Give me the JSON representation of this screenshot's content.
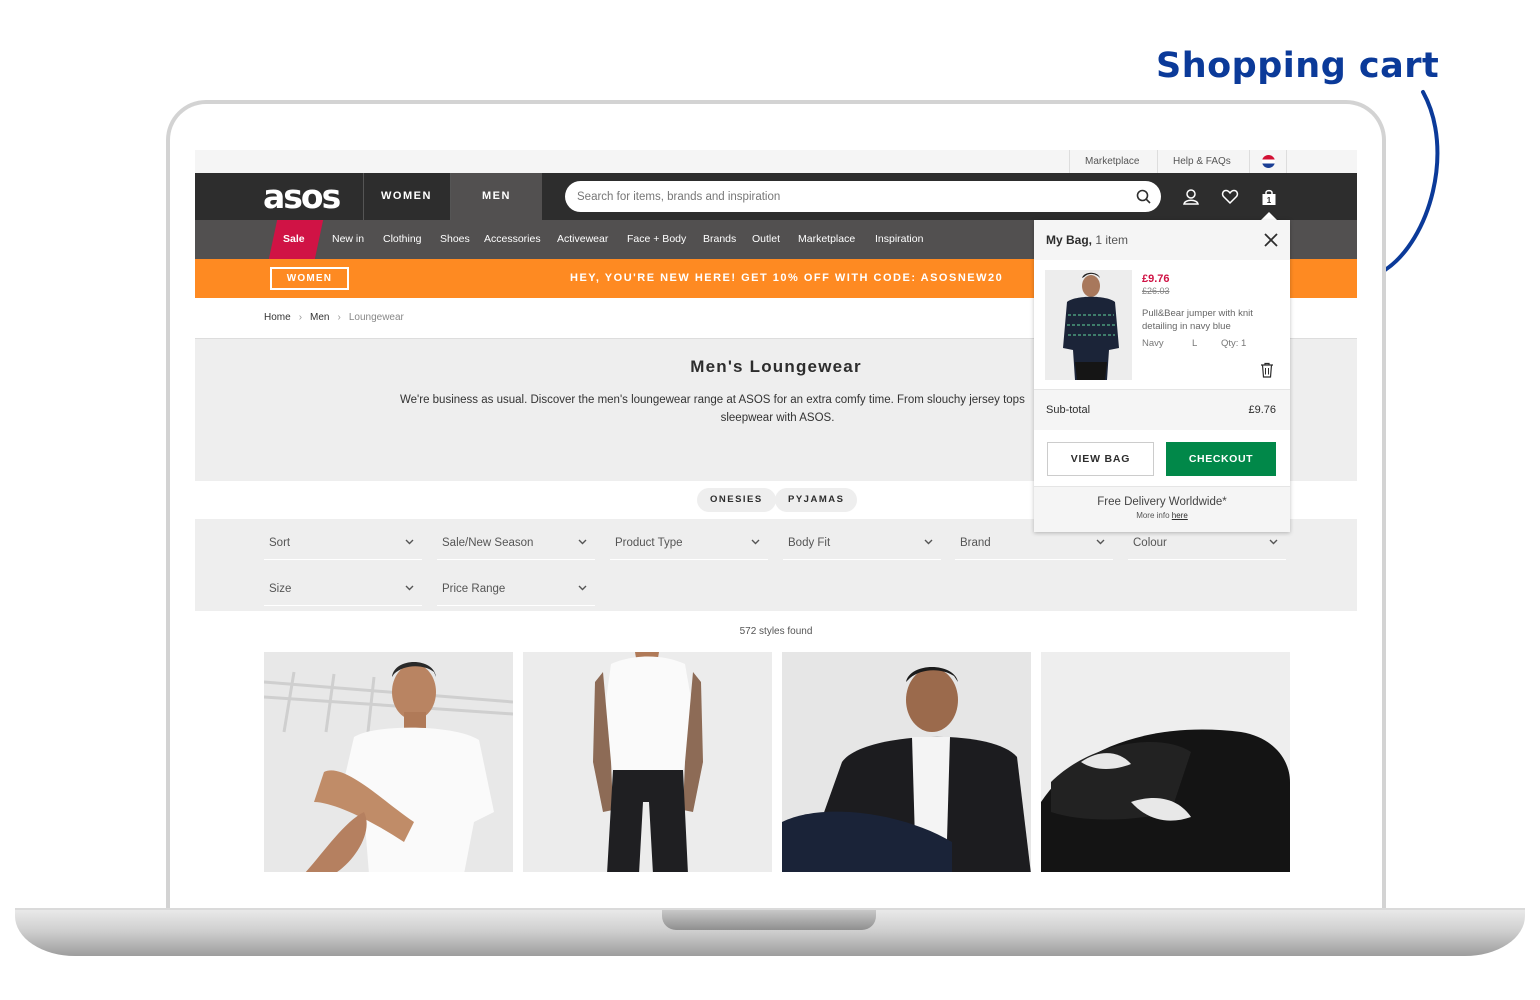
{
  "annotation": {
    "title": "Shopping cart",
    "color": "#0b3a99"
  },
  "topbar": {
    "links": [
      "Marketplace",
      "Help & FAQs"
    ]
  },
  "header": {
    "logo": "asos",
    "tabs": [
      "WOMEN",
      "MEN"
    ],
    "active_tab": "MEN",
    "search_placeholder": "Search for items, brands and inspiration",
    "bag_count": "1"
  },
  "categories": [
    "Sale",
    "New in",
    "Clothing",
    "Shoes",
    "Accessories",
    "Activewear",
    "Face + Body",
    "Brands",
    "Outlet",
    "Marketplace",
    "Inspiration"
  ],
  "promo": {
    "button": "WOMEN",
    "text": "HEY, YOU'RE NEW HERE! GET 10% OFF WITH CODE: ASOSNEW20",
    "color": "#fe8a22"
  },
  "breadcrumb": [
    "Home",
    "Men",
    "Loungewear"
  ],
  "hero": {
    "title": "Men's Loungewear",
    "description_line1": "We're business as usual. Discover the men's loungewear range at ASOS for an extra comfy time. From slouchy jersey tops",
    "description_line2": "sleepwear with ASOS."
  },
  "pills": [
    "ONESIES",
    "PYJAMAS"
  ],
  "filters": [
    "Sort",
    "Sale/New Season",
    "Product Type",
    "Body Fit",
    "Brand",
    "Colour",
    "Size",
    "Price Range"
  ],
  "results": {
    "count_text": "572 styles found"
  },
  "bag": {
    "title": "My Bag,",
    "count": "1 item",
    "item": {
      "price": "£9.76",
      "was": "£26.03",
      "name": "Pull&Bear jumper with knit detailing in navy blue",
      "colour": "Navy",
      "size": "L",
      "qty": "Qty: 1"
    },
    "subtotal_label": "Sub-total",
    "subtotal_value": "£9.76",
    "view_bag": "VIEW BAG",
    "checkout": "CHECKOUT",
    "delivery": "Free Delivery Worldwide*",
    "more_info": "More info",
    "here": "here",
    "sale_color": "#d01345",
    "checkout_color": "#018849"
  }
}
